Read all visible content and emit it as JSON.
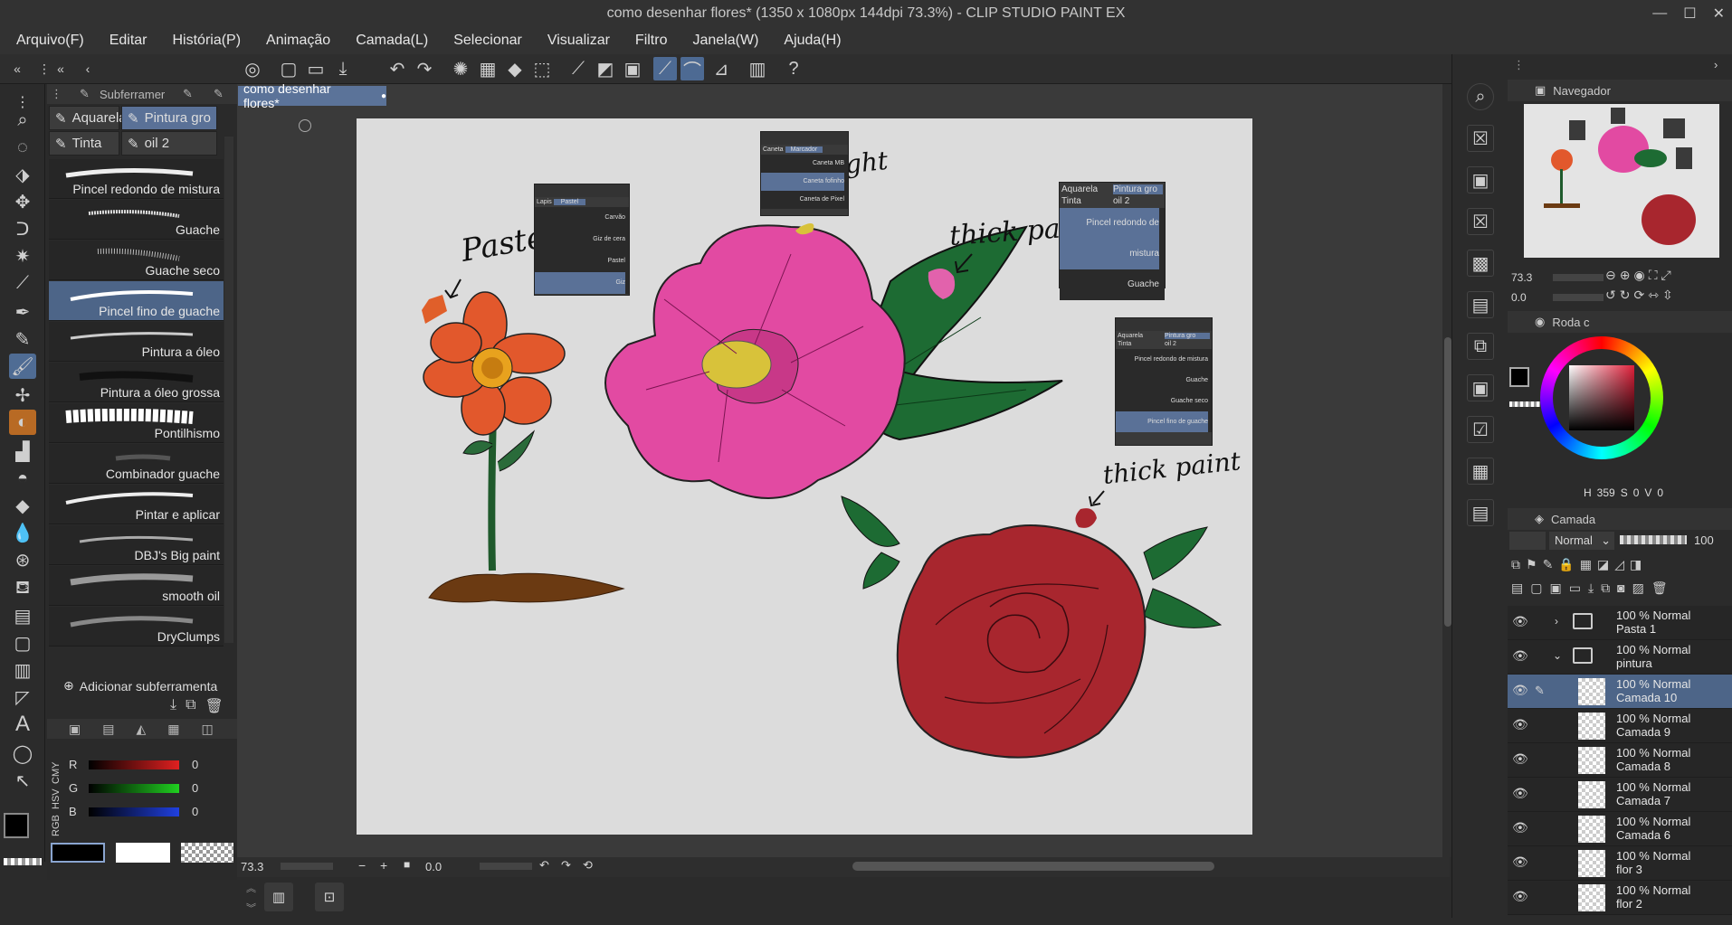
{
  "window": {
    "title": "como desenhar flores* (1350 x 1080px 144dpi 73.3%) - CLIP STUDIO PAINT EX"
  },
  "menu": [
    "Arquivo(F)",
    "Editar",
    "História(P)",
    "Animação",
    "Camada(L)",
    "Selecionar",
    "Visualizar",
    "Filtro",
    "Janela(W)",
    "Ajuda(H)"
  ],
  "subtool": {
    "header": "Subferramer",
    "tabs": [
      "Aquarela",
      "Pintura gro",
      "Tinta",
      "oil 2"
    ],
    "brushes": [
      "Pincel redondo de mistura",
      "Guache",
      "Guache seco",
      "Pincel fino de guache",
      "Pintura a óleo",
      "Pintura a óleo grossa",
      "Pontilhismo",
      "Combinador guache",
      "Pintar e aplicar",
      "DBJ's Big paint",
      "smooth oil",
      "DryClumps"
    ],
    "selected_index": 3,
    "add_label": "Adicionar subferramenta"
  },
  "color_sliders": {
    "mode_tabs": [
      "RGB",
      "HSV",
      "CMY"
    ],
    "channels": [
      {
        "label": "R",
        "value": "0",
        "color": "#e02020"
      },
      {
        "label": "G",
        "value": "0",
        "color": "#20d020"
      },
      {
        "label": "B",
        "value": "0",
        "color": "#2040e0"
      }
    ]
  },
  "document": {
    "tab_label": "como desenhar flores*"
  },
  "canvas": {
    "annotations": [
      "Pastel",
      "Hightight",
      "thick paint",
      "thick paint"
    ],
    "mini_panels": {
      "pastel": {
        "tabs": [
          "Lapis",
          "Pastel"
        ],
        "items": [
          "Carvão",
          "Giz de cera",
          "Pastel",
          "Giz"
        ]
      },
      "highlight": {
        "tabs": [
          "Caneta",
          "Marcador"
        ],
        "items": [
          "Caneta MB",
          "Caneta fofinho",
          "Caneta de Pixel"
        ]
      },
      "thick1": {
        "tabs": [
          "Aquarela",
          "Pintura gro",
          "Tinta",
          "oil 2"
        ],
        "items": [
          "Pincel redondo de mistura",
          "Guache"
        ]
      },
      "thick2": {
        "tabs": [
          "Aquarela",
          "Pintura gro",
          "Tinta",
          "oil 2"
        ],
        "items": [
          "Pincel redondo de mistura",
          "Guache",
          "Guache seco",
          "Pincel fino de guache"
        ]
      }
    }
  },
  "statusbar": {
    "zoom": "73.3",
    "rotation": "0.0"
  },
  "navigator": {
    "title": "Navegador",
    "zoom": "73.3",
    "angle": "0.0"
  },
  "color_wheel": {
    "title": "Roda c",
    "hsv": {
      "h": "359",
      "s": "0",
      "v": "0"
    },
    "labels": {
      "h": "H",
      "s": "S",
      "v": "V"
    }
  },
  "layers": {
    "title": "Camada",
    "blend_mode": "Normal",
    "opacity": "100",
    "items": [
      {
        "line1": "100 % Normal",
        "line2": "Pasta 1",
        "type": "folder",
        "selected": false
      },
      {
        "line1": "100 % Normal",
        "line2": "pintura",
        "type": "folder",
        "selected": false
      },
      {
        "line1": "100 % Normal",
        "line2": "Camada 10",
        "type": "layer",
        "selected": true
      },
      {
        "line1": "100 % Normal",
        "line2": "Camada 9",
        "type": "layer",
        "selected": false
      },
      {
        "line1": "100 % Normal",
        "line2": "Camada 8",
        "type": "layer",
        "selected": false
      },
      {
        "line1": "100 % Normal",
        "line2": "Camada 7",
        "type": "layer",
        "selected": false
      },
      {
        "line1": "100 % Normal",
        "line2": "Camada 6",
        "type": "layer",
        "selected": false
      },
      {
        "line1": "100 % Normal",
        "line2": "flor 3",
        "type": "layer",
        "selected": false
      },
      {
        "line1": "100 % Normal",
        "line2": "flor 2",
        "type": "layer",
        "selected": false
      }
    ]
  },
  "colors": {
    "accent": "#5a7197",
    "panel": "#2b2b2b",
    "canvas_bg": "#dcdcdc"
  }
}
